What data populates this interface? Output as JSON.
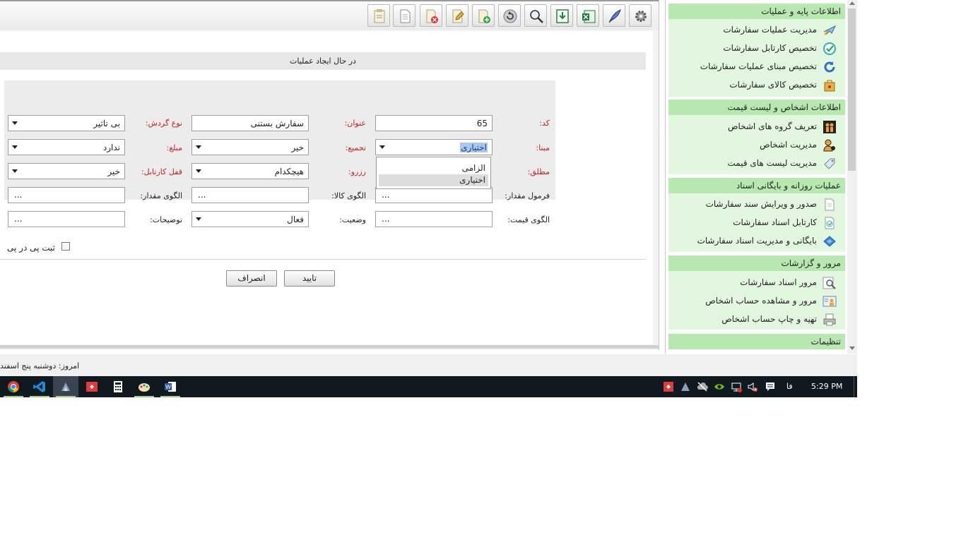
{
  "form": {
    "title": "در حال ایجاد عملیات",
    "fields": {
      "code": {
        "label": "کد:",
        "value": "65"
      },
      "title": {
        "label": "عنوان:",
        "value": "سفارش بستنی"
      },
      "cycle_type": {
        "label": "نوع گردش:",
        "value": "بی تاثیر"
      },
      "basis": {
        "label": "مبنا:",
        "value": "اختیاری"
      },
      "aggregate": {
        "label": "تجمیع:",
        "value": "خیر"
      },
      "amount": {
        "label": "مبلغ:",
        "value": "ندارد"
      },
      "absolute": {
        "label": "مطلق:"
      },
      "reserve": {
        "label": "رزرو:",
        "value": "هیچکدام"
      },
      "lock_cardex": {
        "label": "قفل کارتابل:",
        "value": "خیر"
      },
      "quantity_formula": {
        "label": "فرمول مقدار:",
        "value": "..."
      },
      "goods_pattern": {
        "label": "الگوی کالا:",
        "value": "..."
      },
      "quantity_pattern": {
        "label": "الگوی مقدار:",
        "value": "..."
      },
      "price_pattern": {
        "label": "الگوی قیمت:",
        "value": "..."
      },
      "status": {
        "label": "وضعیت:",
        "value": "فعال"
      },
      "description": {
        "label": "توضیحات:",
        "value": "..."
      }
    },
    "dropdown_options": [
      "الزامی",
      "اختیاری"
    ],
    "checkbox_label": "ثبت پی در پی",
    "confirm_label": "تایید",
    "cancel_label": "انصراف"
  },
  "status_bar": {
    "text": "امروز: دوشنبه پنج اسفند"
  },
  "sidebar": {
    "sections": [
      {
        "title": "اطلاعات پایه و عملیات",
        "items": [
          {
            "label": "مدیریت عملیات سفارشات",
            "icon": "plane-icon"
          },
          {
            "label": "تخصیص کارتابل سفارشات",
            "icon": "check-circle-icon"
          },
          {
            "label": "تخصیص مبنای عملیات سفارشات",
            "icon": "refresh-icon"
          },
          {
            "label": "تخصیص کالای سفارشات",
            "icon": "package-icon"
          }
        ]
      },
      {
        "title": "اطلاعات اشخاص و لیست قیمت",
        "items": [
          {
            "label": "تعریف گروه های اشخاص",
            "icon": "group-icon"
          },
          {
            "label": "مدیریت اشخاص",
            "icon": "person-icon"
          },
          {
            "label": "مدیریت لیست های قیمت",
            "icon": "price-tag-icon"
          }
        ]
      },
      {
        "title": "عملیات روزانه و بایگانی اسناد",
        "items": [
          {
            "label": "صدور و ویرایش سند سفارشات",
            "icon": "document-icon"
          },
          {
            "label": "کارتابل اسناد سفارشات",
            "icon": "document-check-icon"
          },
          {
            "label": "بایگانی و مدیریت اسناد سفارشات",
            "icon": "archive-icon"
          }
        ]
      },
      {
        "title": "مرور و گزارشات",
        "items": [
          {
            "label": "مرور اسناد سفارشات",
            "icon": "magnifier-icon"
          },
          {
            "label": "مرور و مشاهده حساب اشخاص",
            "icon": "person-card-icon"
          },
          {
            "label": "تهیه و چاپ حساب اشخاص",
            "icon": "print-icon"
          }
        ]
      },
      {
        "title": "تنظیمات",
        "items": []
      }
    ]
  },
  "taskbar": {
    "clock": "5:29 PM",
    "language": "فا"
  },
  "colors": {
    "sidebar_header": "#b6e8b0",
    "sidebar_body": "#e3f6e0",
    "required_label": "#c81e1e",
    "taskbar": "#101820"
  }
}
